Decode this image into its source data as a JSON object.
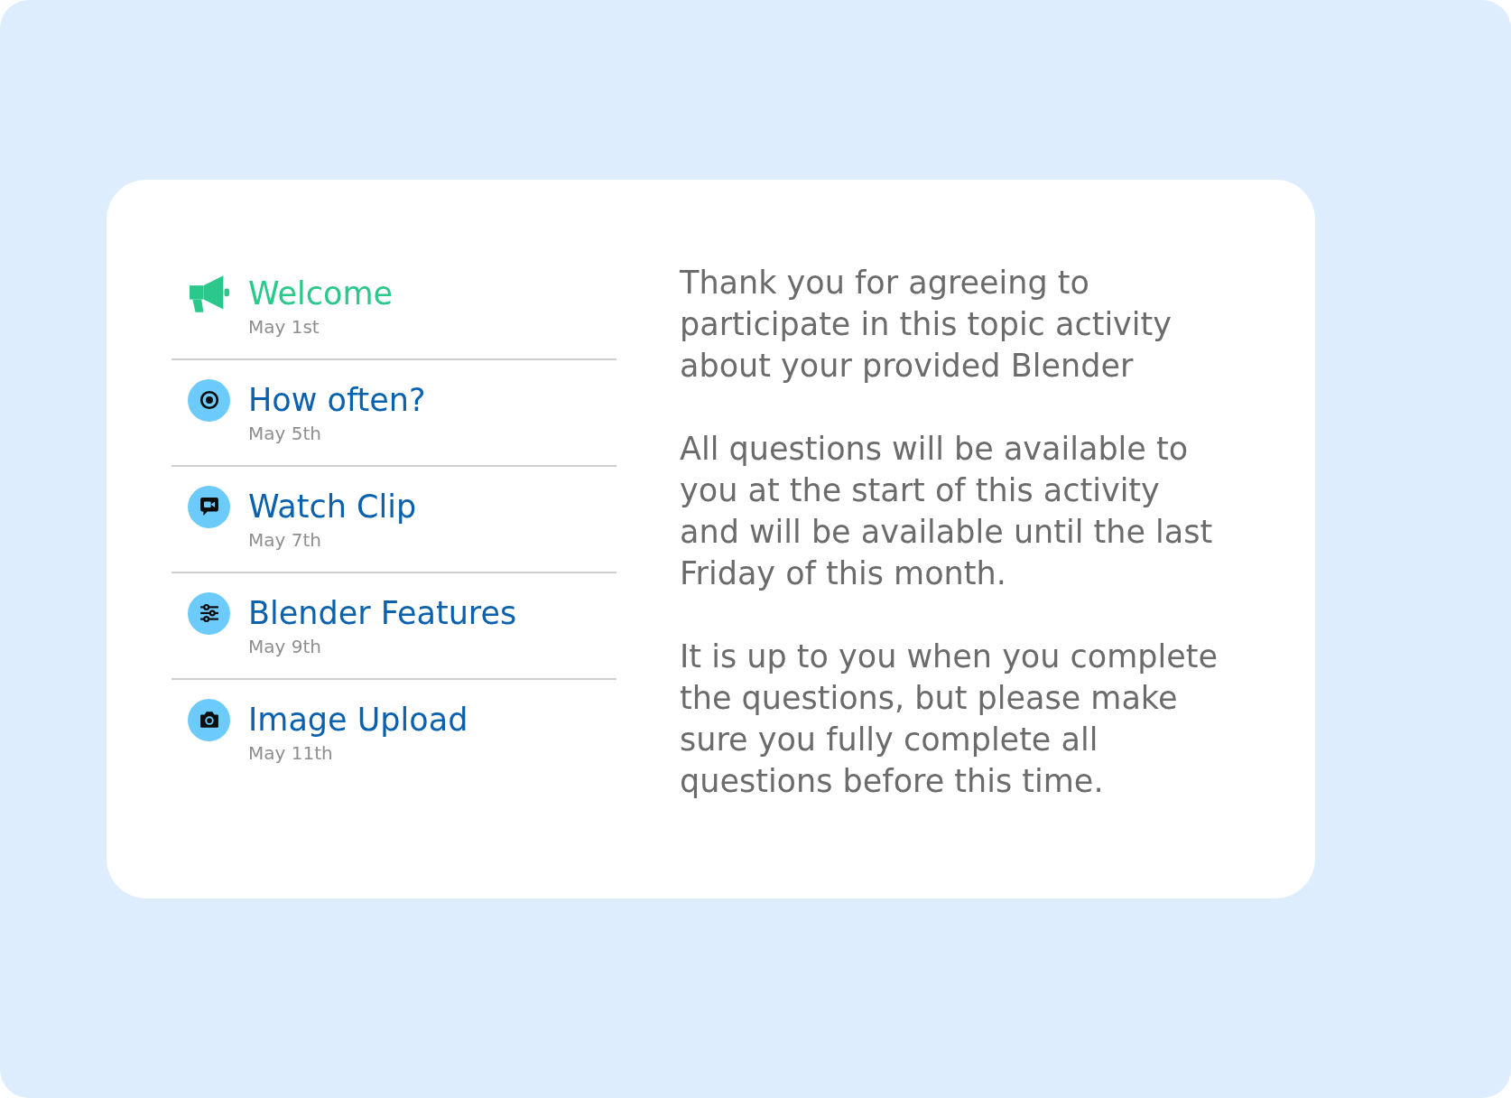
{
  "topics": [
    {
      "title": "Welcome",
      "date": "May 1st",
      "selected": true
    },
    {
      "title": "How often?",
      "date": "May 5th",
      "selected": false
    },
    {
      "title": "Watch Clip",
      "date": "May 7th",
      "selected": false
    },
    {
      "title": "Blender Features",
      "date": "May 9th",
      "selected": false
    },
    {
      "title": "Image Upload",
      "date": "May 11th",
      "selected": false
    }
  ],
  "description": {
    "paragraphs": [
      "Thank you for agreeing to participate in this topic activity about your provided Blender",
      "All questions will be available to you at the start of this activity and will be available until the last Friday of this month.",
      "It is up to you when you complete the questions, but please make sure you fully complete all questions before this time."
    ]
  }
}
